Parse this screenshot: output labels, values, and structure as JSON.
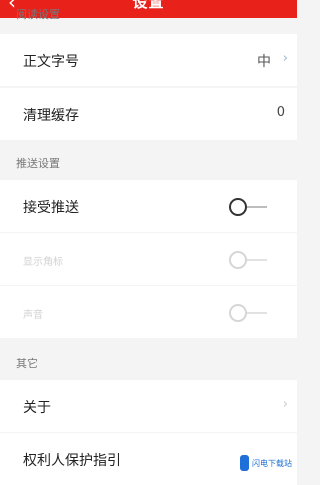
{
  "header": {
    "title": "设置",
    "back_icon": "chevron-left-icon"
  },
  "sections": {
    "reading": {
      "title": "阅读设置"
    },
    "push": {
      "title": "推送设置"
    },
    "other": {
      "title": "其它"
    }
  },
  "rows": {
    "font_size": {
      "label": "正文字号",
      "value": "中",
      "icon": "chevron-right-icon"
    },
    "clear_cache": {
      "label": "清理缓存",
      "value": "0"
    },
    "accept_push": {
      "label": "接受推送",
      "enabled": false
    },
    "show_badge": {
      "label": "显示角标",
      "enabled": false,
      "disabled": true
    },
    "sound": {
      "label": "声音",
      "enabled": false,
      "disabled": true
    },
    "about": {
      "label": "关于",
      "icon": "chevron-right-icon"
    },
    "rights": {
      "label": "权利人保护指引"
    }
  },
  "colors": {
    "header_bg": "#e8211b",
    "page_bg": "#f4f4f4",
    "row_bg": "#ffffff"
  },
  "watermark": {
    "text": "闪电下载站"
  }
}
